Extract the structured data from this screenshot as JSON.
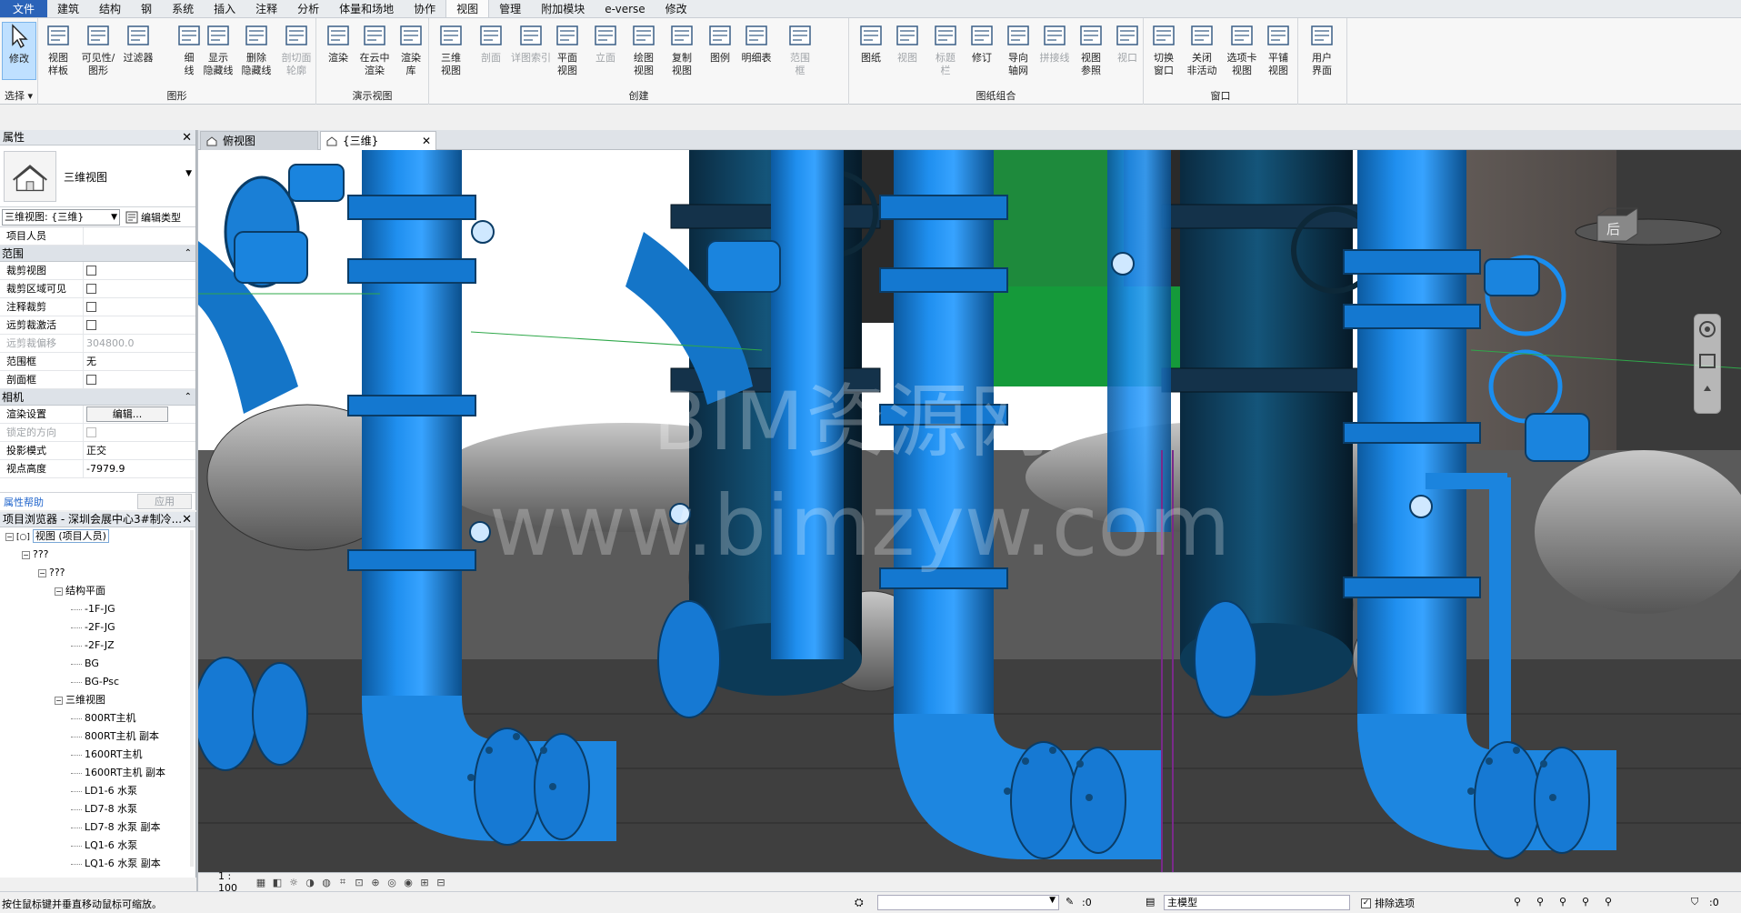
{
  "menu": [
    "文件",
    "建筑",
    "结构",
    "钢",
    "系统",
    "插入",
    "注释",
    "分析",
    "体量和场地",
    "协作",
    "视图",
    "管理",
    "附加模块",
    "e-verse",
    "修改"
  ],
  "active_menu": "视图",
  "ribbon": {
    "select": {
      "label": "修改",
      "group": "选择"
    },
    "graphics": {
      "group": "图形",
      "tools": [
        "视图\n样板",
        "可见性/\n图形",
        "过滤器",
        "细\n线",
        "显示\n隐藏线",
        "删除\n隐藏线",
        "剖切面\n轮廓"
      ]
    },
    "presentation": {
      "group": "演示视图",
      "tools": [
        "渲染",
        "在云中\n渲染",
        "渲染\n库"
      ]
    },
    "create": {
      "group": "创建",
      "tools": [
        "三维\n视图",
        "剖面",
        "详图索引",
        "平面\n视图",
        "立面",
        "绘图\n视图",
        "复制\n视图",
        "图例",
        "明细表",
        "范围\n框"
      ]
    },
    "sheet": {
      "group": "图纸组合",
      "tools": [
        "图纸",
        "视图",
        "标题\n栏",
        "修订",
        "导向\n轴网",
        "拼接线",
        "视图\n参照",
        "视口"
      ]
    },
    "windows": {
      "group": "窗口",
      "tools": [
        "切换\n窗口",
        "关闭\n非活动",
        "选项卡\n视图",
        "平铺\n视图"
      ]
    },
    "ui": {
      "tools": [
        "用户\n界面"
      ]
    }
  },
  "tabs": [
    {
      "label": "俯视图",
      "active": false
    },
    {
      "label": "{三维}",
      "active": true
    }
  ],
  "properties": {
    "title": "属性",
    "type_name": "三维视图",
    "instance_selector": "三维视图: {三维}",
    "edit_type": "编辑类型",
    "project_person": "项目人员",
    "sections": [
      {
        "name": "范围",
        "rows": [
          {
            "k": "裁剪视图",
            "type": "cb",
            "v": ""
          },
          {
            "k": "裁剪区域可见",
            "type": "cb",
            "v": ""
          },
          {
            "k": "注释裁剪",
            "type": "cb",
            "v": ""
          },
          {
            "k": "远剪裁激活",
            "type": "cb",
            "v": ""
          },
          {
            "k": "远剪裁偏移",
            "type": "text",
            "v": "304800.0",
            "dim": true
          },
          {
            "k": "范围框",
            "type": "text",
            "v": "无"
          },
          {
            "k": "剖面框",
            "type": "cb",
            "v": ""
          }
        ]
      },
      {
        "name": "相机",
        "rows": [
          {
            "k": "渲染设置",
            "type": "btn",
            "v": "编辑..."
          },
          {
            "k": "锁定的方向",
            "type": "cb",
            "v": "",
            "dim": true
          },
          {
            "k": "投影模式",
            "type": "text",
            "v": "正交"
          },
          {
            "k": "视点高度",
            "type": "text",
            "v": "-7979.9"
          }
        ]
      }
    ],
    "help": "属性帮助",
    "apply": "应用"
  },
  "browser": {
    "title": "项目浏览器 - 深圳会展中心3#制冷...",
    "nodes": [
      {
        "label": "视图 (项目人员)",
        "level": 0,
        "toggle": "-",
        "selected": true
      },
      {
        "label": "???",
        "level": 1,
        "toggle": "-"
      },
      {
        "label": "???",
        "level": 2,
        "toggle": "-"
      },
      {
        "label": "结构平面",
        "level": 3,
        "toggle": "-"
      },
      {
        "label": "-1F-JG",
        "level": 4
      },
      {
        "label": "-2F-JG",
        "level": 4
      },
      {
        "label": "-2F-JZ",
        "level": 4
      },
      {
        "label": "BG",
        "level": 4
      },
      {
        "label": "BG-Psc",
        "level": 4
      },
      {
        "label": "三维视图",
        "level": 3,
        "toggle": "-"
      },
      {
        "label": "800RT主机",
        "level": 4
      },
      {
        "label": "800RT主机 副本",
        "level": 4
      },
      {
        "label": "1600RT主机",
        "level": 4
      },
      {
        "label": "1600RT主机 副本",
        "level": 4
      },
      {
        "label": "LD1-6 水泵",
        "level": 4
      },
      {
        "label": "LD7-8 水泵",
        "level": 4
      },
      {
        "label": "LD7-8 水泵 副本",
        "level": 4
      },
      {
        "label": "LQ1-6 水泵",
        "level": 4
      },
      {
        "label": "LQ1-6 水泵 副本",
        "level": 4
      }
    ]
  },
  "canvas": {
    "watermark1": "BIM资源网",
    "watermark2": "www.bimzyw.com",
    "viewcube_label": "后",
    "colors": {
      "pipe": "#1f8be8",
      "pipe_dark": "#0d5a9c",
      "pump": "#9a9a9a",
      "wall": "#4a4a4a",
      "green": "#1a9a3a"
    }
  },
  "view_control": {
    "scale": "1 : 100"
  },
  "status": {
    "message": "按住鼠标键并垂直移动鼠标可缩放。",
    "zero1": ":0",
    "model": "主模型",
    "exclude": "排除选项",
    "zero2": ":0"
  }
}
